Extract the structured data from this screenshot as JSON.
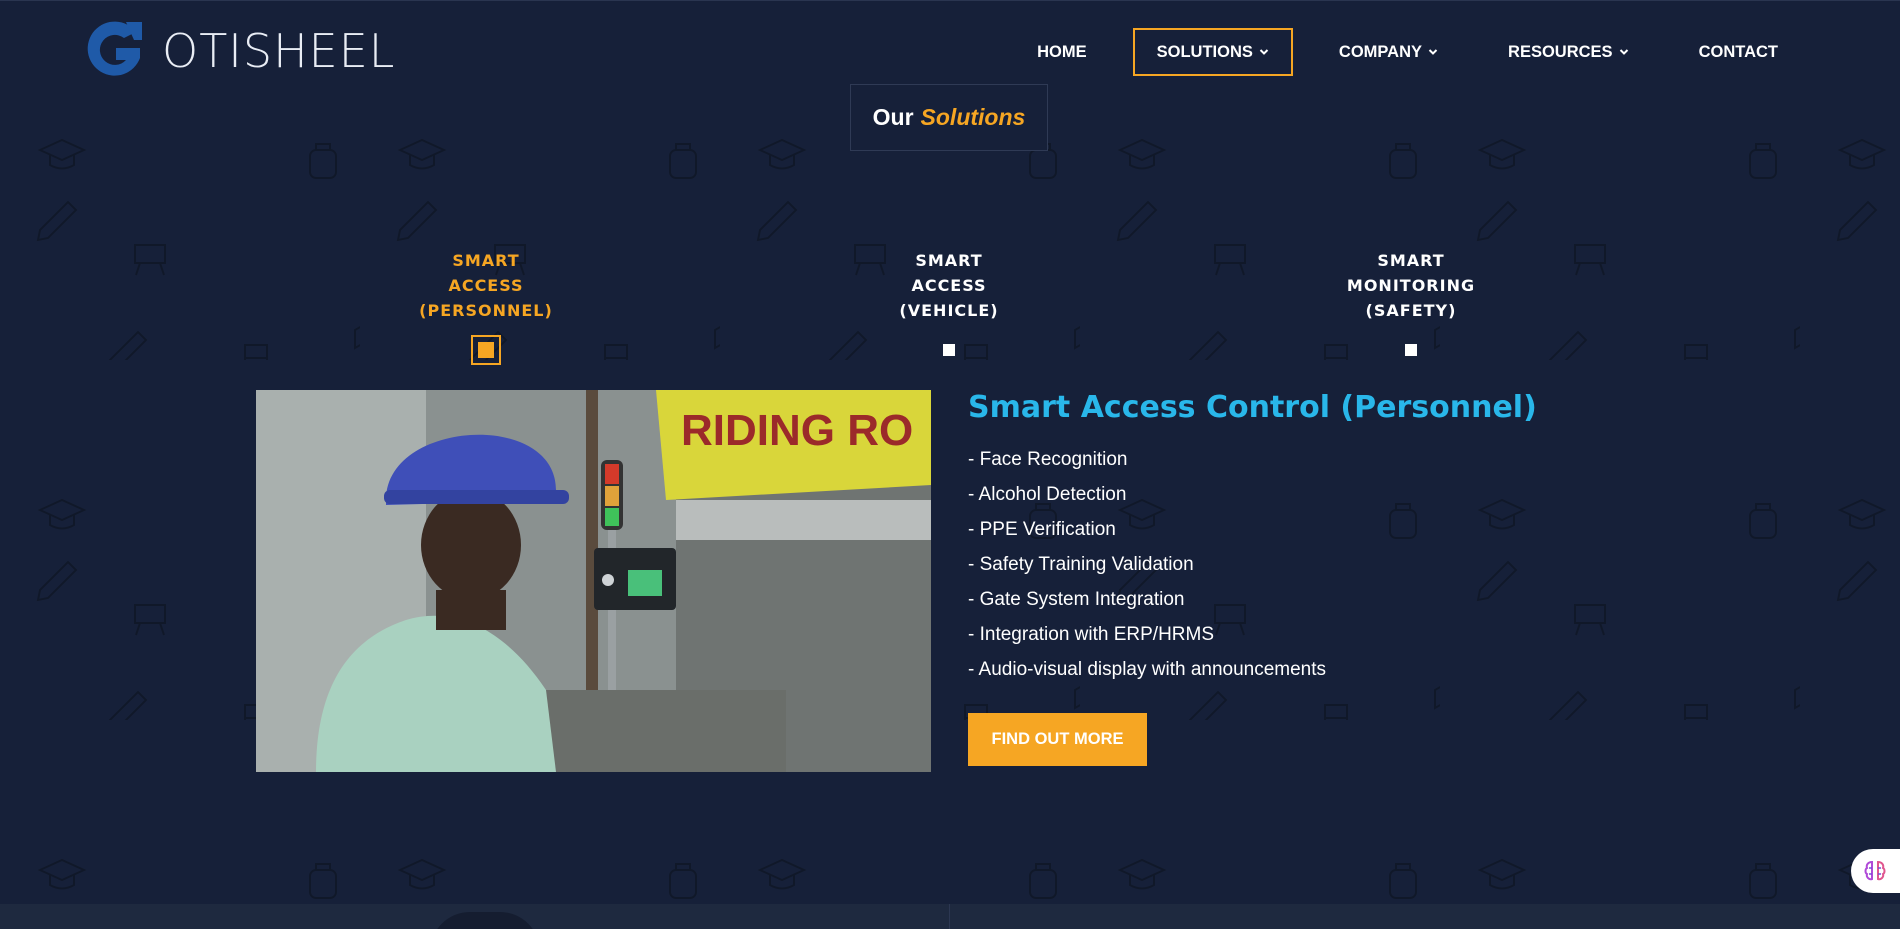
{
  "brand": {
    "name": "OTISHEEL",
    "accent_color": "#f6a623",
    "title_color": "#29b7ea",
    "background_color": "#162039"
  },
  "nav": {
    "items": [
      {
        "label": "HOME",
        "has_dropdown": false,
        "active": false
      },
      {
        "label": "SOLUTIONS",
        "has_dropdown": true,
        "active": true
      },
      {
        "label": "COMPANY",
        "has_dropdown": true,
        "active": false
      },
      {
        "label": "RESOURCES",
        "has_dropdown": true,
        "active": false
      },
      {
        "label": "CONTACT",
        "has_dropdown": false,
        "active": false
      }
    ],
    "dropdown_icon": "chevron-down-icon"
  },
  "section": {
    "heading_word1": "Our",
    "heading_word2": "Solutions"
  },
  "tabs": [
    {
      "line1": "SMART",
      "line2": "ACCESS",
      "line3": "(PERSONNEL)",
      "active": true
    },
    {
      "line1": "SMART",
      "line2": "ACCESS",
      "line3": "(VEHICLE)",
      "active": false
    },
    {
      "line1": "SMART",
      "line2": "MONITORING",
      "line3": "(SAFETY)",
      "active": false
    }
  ],
  "content": {
    "title": "Smart Access Control (Personnel)",
    "features": [
      "- Face Recognition",
      "- Alcohol Detection",
      "- PPE Verification",
      "- Safety Training Validation",
      "- Gate System Integration",
      "- Integration with ERP/HRMS",
      "- Audio-visual display with announcements"
    ],
    "cta_label": "FIND OUT MORE"
  },
  "photo": {
    "banner_text": "RIDING RO",
    "description_icon": "worker-at-access-gate-photo"
  },
  "widget": {
    "icon": "brain-icon"
  }
}
